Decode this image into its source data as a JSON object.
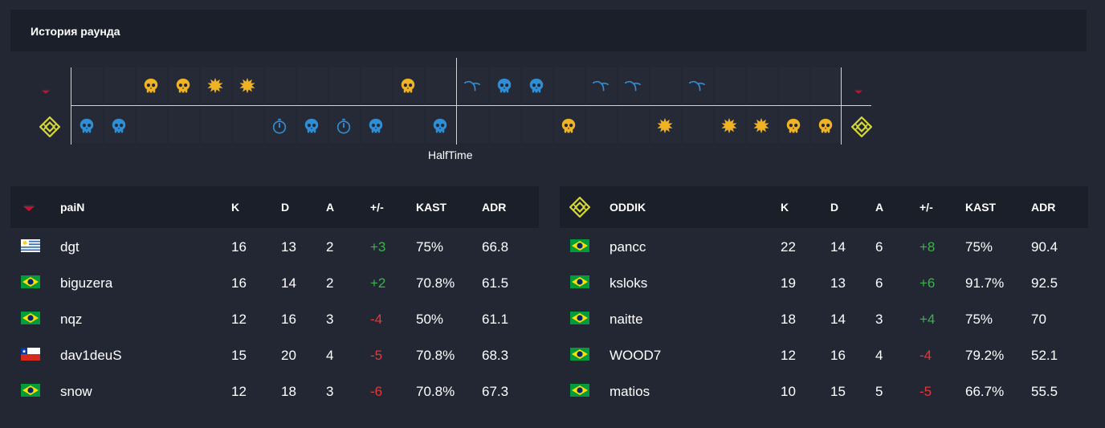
{
  "header": {
    "title": "История раунда"
  },
  "timeline": {
    "halftime_label": "HalfTime",
    "top_team": "paiN",
    "bottom_team": "ODDIK",
    "top_row": [
      "",
      "",
      "skull-gold",
      "skull-gold",
      "explosion-gold",
      "explosion-gold",
      "",
      "",
      "",
      "",
      "skull-gold",
      "",
      "scissors-blue",
      "skull-blue",
      "skull-blue",
      "",
      "scissors-blue",
      "scissors-blue",
      "",
      "scissors-blue",
      "",
      "",
      "",
      "",
      ""
    ],
    "bottom_row": [
      "skull-blue",
      "skull-blue",
      "",
      "",
      "",
      "",
      "timer-blue",
      "skull-blue",
      "timer-blue",
      "skull-blue",
      "",
      "skull-blue",
      "",
      "",
      "",
      "skull-gold",
      "",
      "",
      "explosion-gold",
      "",
      "explosion-gold",
      "explosion-gold",
      "skull-gold",
      "skull-gold"
    ]
  },
  "colors": {
    "gold": "#f0b323",
    "blue": "#2f8fd6",
    "green": "#3bb54a",
    "red": "#e03a3a",
    "oddik": "#d5d833"
  },
  "columns": [
    "K",
    "D",
    "A",
    "+/-",
    "KAST",
    "ADR"
  ],
  "teams": [
    {
      "name": "paiN",
      "players": [
        {
          "flag": "uy",
          "name": "dgt",
          "k": "16",
          "d": "13",
          "a": "2",
          "pm": "+3",
          "kast": "75%",
          "adr": "66.8"
        },
        {
          "flag": "br",
          "name": "biguzera",
          "k": "16",
          "d": "14",
          "a": "2",
          "pm": "+2",
          "kast": "70.8%",
          "adr": "61.5"
        },
        {
          "flag": "br",
          "name": "nqz",
          "k": "12",
          "d": "16",
          "a": "3",
          "pm": "-4",
          "kast": "50%",
          "adr": "61.1"
        },
        {
          "flag": "cl",
          "name": "dav1deuS",
          "k": "15",
          "d": "20",
          "a": "4",
          "pm": "-5",
          "kast": "70.8%",
          "adr": "68.3"
        },
        {
          "flag": "br",
          "name": "snow",
          "k": "12",
          "d": "18",
          "a": "3",
          "pm": "-6",
          "kast": "70.8%",
          "adr": "67.3"
        }
      ]
    },
    {
      "name": "ODDIK",
      "players": [
        {
          "flag": "br",
          "name": "pancc",
          "k": "22",
          "d": "14",
          "a": "6",
          "pm": "+8",
          "kast": "75%",
          "adr": "90.4"
        },
        {
          "flag": "br",
          "name": "ksloks",
          "k": "19",
          "d": "13",
          "a": "6",
          "pm": "+6",
          "kast": "91.7%",
          "adr": "92.5"
        },
        {
          "flag": "br",
          "name": "naitte",
          "k": "18",
          "d": "14",
          "a": "3",
          "pm": "+4",
          "kast": "75%",
          "adr": "70"
        },
        {
          "flag": "br",
          "name": "WOOD7",
          "k": "12",
          "d": "16",
          "a": "4",
          "pm": "-4",
          "kast": "79.2%",
          "adr": "52.1"
        },
        {
          "flag": "br",
          "name": "matios",
          "k": "10",
          "d": "15",
          "a": "5",
          "pm": "-5",
          "kast": "66.7%",
          "adr": "55.5"
        }
      ]
    }
  ]
}
